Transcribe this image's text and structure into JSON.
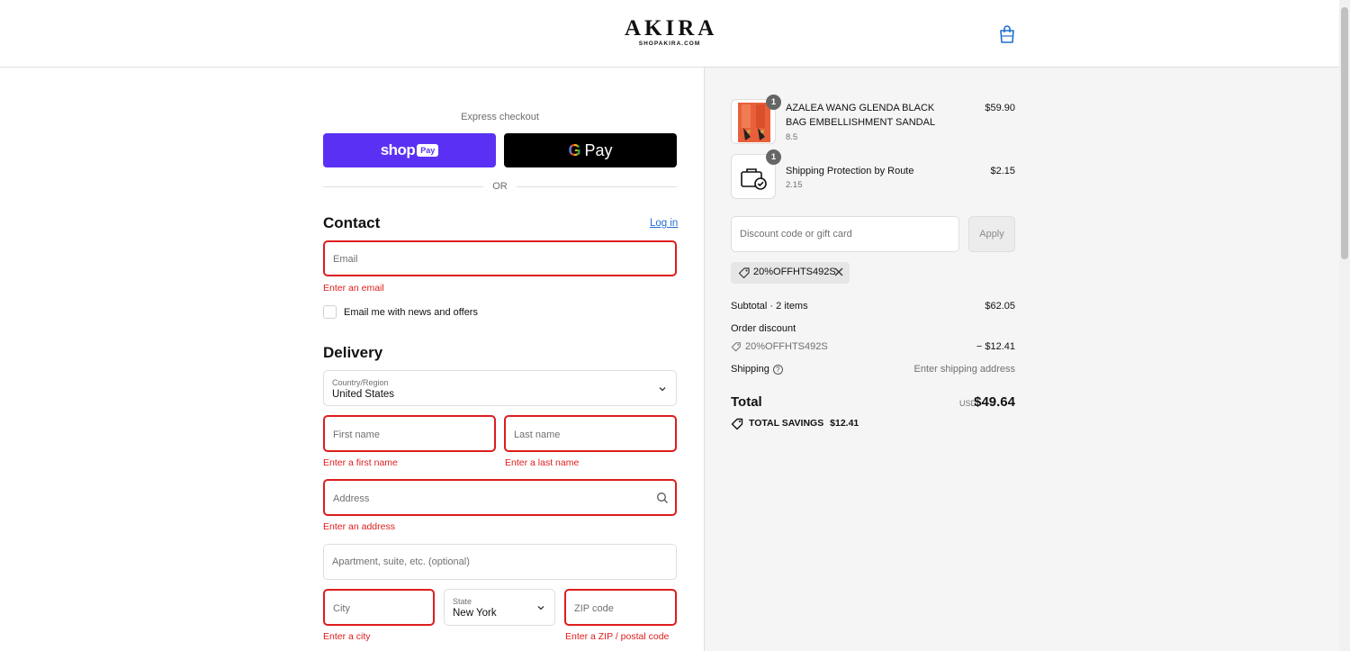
{
  "header": {
    "logo_main": "AKIRA",
    "logo_sub": "SHOPAKIRA.COM",
    "cart_icon": "shopping-bag-icon"
  },
  "express": {
    "title": "Express checkout",
    "shop_pay_text": "shop",
    "shop_pay_badge": "Pay",
    "gpay_g": "G",
    "gpay_text": "Pay",
    "or_text": "OR"
  },
  "contact": {
    "title": "Contact",
    "login_label": "Log in",
    "email_placeholder": "Email",
    "email_error": "Enter an email",
    "newsletter_label": "Email me with news and offers"
  },
  "delivery": {
    "title": "Delivery",
    "country_label": "Country/Region",
    "country_value": "United States",
    "first_name_placeholder": "First name",
    "first_name_error": "Enter a first name",
    "last_name_placeholder": "Last name",
    "last_name_error": "Enter a last name",
    "address_placeholder": "Address",
    "address_error": "Enter an address",
    "apartment_placeholder": "Apartment, suite, etc. (optional)",
    "city_placeholder": "City",
    "city_error": "Enter a city",
    "state_label": "State",
    "state_value": "New York",
    "zip_placeholder": "ZIP code",
    "zip_error": "Enter a ZIP / postal code"
  },
  "summary": {
    "items": [
      {
        "quantity": "1",
        "name": "AZALEA WANG GLENDA BLACK BAG EMBELLISHMENT SANDAL",
        "variant": "8.5",
        "price": "$59.90"
      },
      {
        "quantity": "1",
        "name": "Shipping Protection by Route",
        "variant": "2.15",
        "price": "$2.15"
      }
    ],
    "discount_placeholder": "Discount code or gift card",
    "apply_label": "Apply",
    "applied_code": "20%OFFHTS492S",
    "subtotal_label": "Subtotal · 2 items",
    "subtotal_value": "$62.05",
    "order_discount_label": "Order discount",
    "order_discount_code": "20%OFFHTS492S",
    "order_discount_value": "− $12.41",
    "shipping_label": "Shipping",
    "shipping_value": "Enter shipping address",
    "total_label": "Total",
    "total_currency": "USD",
    "total_value": "$49.64",
    "savings_label": "TOTAL SAVINGS",
    "savings_value": "$12.41"
  },
  "colors": {
    "shop_pay": "#5a31f4",
    "error": "#dd1d1d",
    "link": "#1f6fd1"
  }
}
